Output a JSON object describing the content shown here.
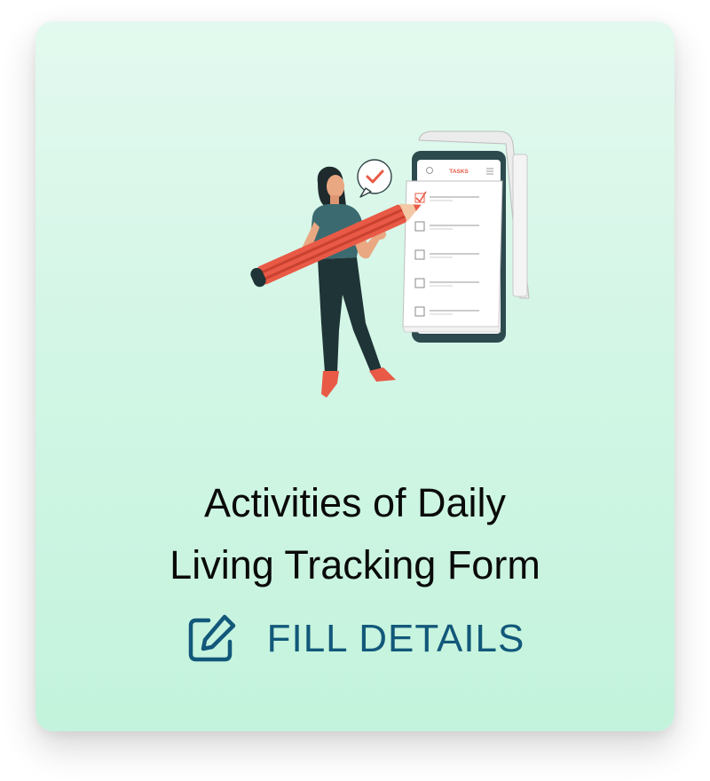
{
  "card": {
    "title_line1": "Activities of Daily",
    "title_line2": "Living Tracking Form",
    "action_label": "FILL DETAILS",
    "action_icon": "edit-icon"
  },
  "illustration": {
    "phone_header": "TASKS",
    "task_checked": [
      true,
      false,
      false,
      false,
      false
    ]
  },
  "colors": {
    "card_gradient_top": "#e3f9ef",
    "card_gradient_bottom": "#c3f3dc",
    "accent": "#12587a",
    "illustration_red": "#e85a46",
    "illustration_dark": "#1f3436"
  }
}
